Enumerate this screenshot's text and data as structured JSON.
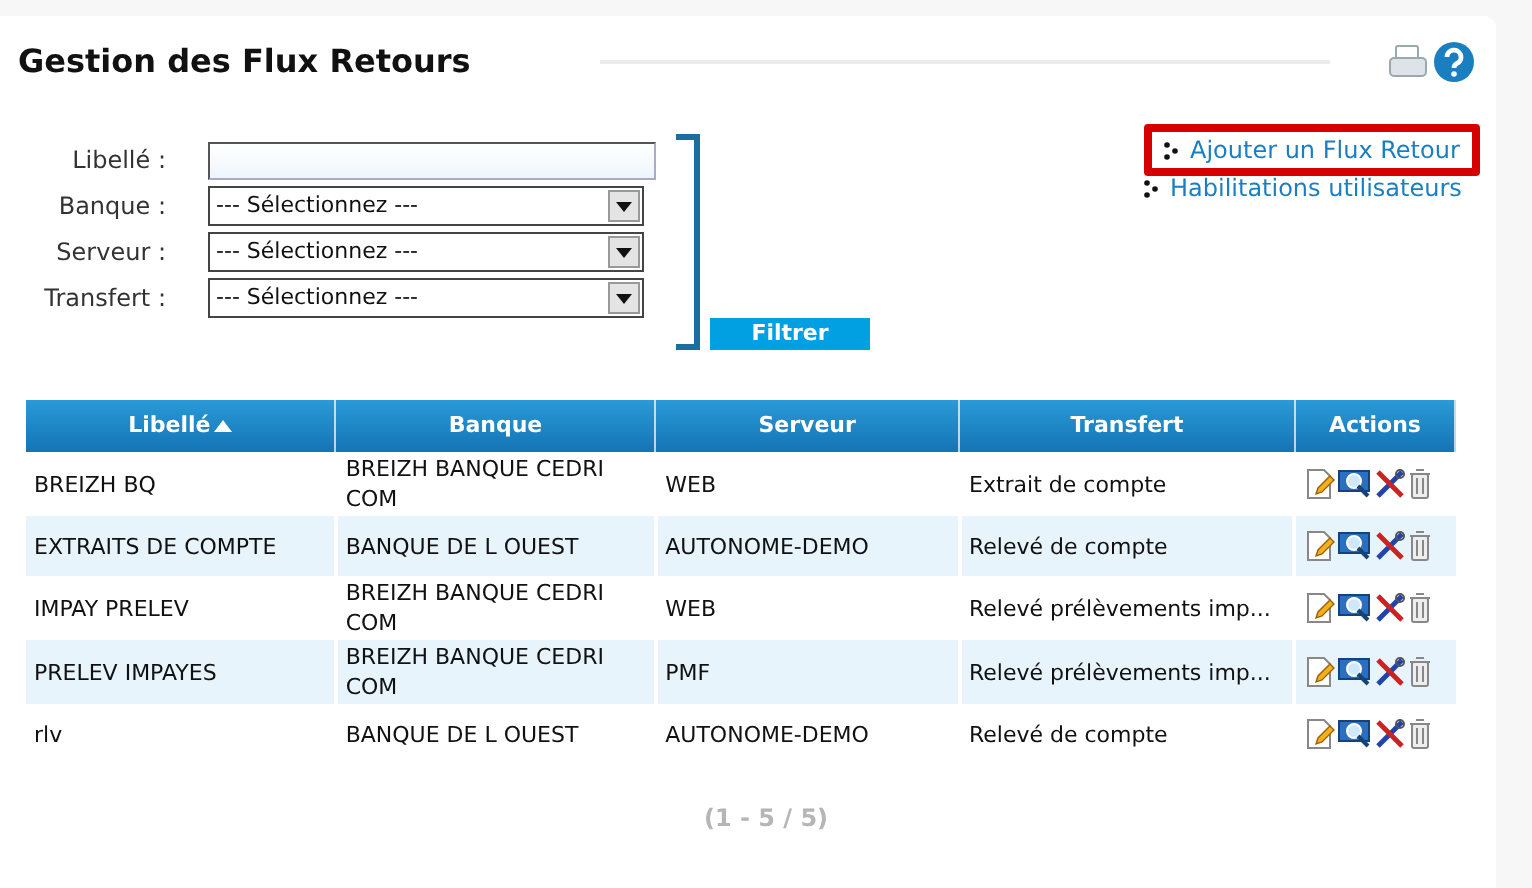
{
  "page": {
    "title": "Gestion des Flux Retours"
  },
  "filters": [
    {
      "kind": "text",
      "label": "Libellé :"
    },
    {
      "kind": "select",
      "label": "Banque :",
      "value": "--- Sélectionnez ---"
    },
    {
      "kind": "select",
      "label": "Serveur :",
      "value": "--- Sélectionnez ---"
    },
    {
      "kind": "select",
      "label": "Transfert :",
      "value": "--- Sélectionnez ---"
    }
  ],
  "filter_button": "Filtrer",
  "links": [
    {
      "label": "Ajouter un Flux Retour",
      "highlighted": true
    },
    {
      "label": "Habilitations utilisateurs",
      "highlighted": false
    }
  ],
  "table": {
    "columns": [
      {
        "label": "Libellé",
        "sorted": true
      },
      {
        "label": "Banque",
        "sorted": false
      },
      {
        "label": "Serveur",
        "sorted": false
      },
      {
        "label": "Transfert",
        "sorted": false
      },
      {
        "label": "Actions",
        "sorted": false
      }
    ],
    "rows": [
      {
        "cells": [
          "BREIZH BQ",
          "BREIZH BANQUE CEDRI COM",
          "WEB",
          "Extrait de compte"
        ]
      },
      {
        "cells": [
          "EXTRAITS DE COMPTE",
          "BANQUE DE L OUEST",
          "AUTONOME-DEMO",
          "Relevé de compte"
        ]
      },
      {
        "cells": [
          "IMPAY PRELEV",
          "BREIZH BANQUE CEDRI COM",
          "WEB",
          "Relevé prélèvements imp..."
        ]
      },
      {
        "cells": [
          "PRELEV IMPAYES",
          "BREIZH BANQUE CEDRI COM",
          "PMF",
          "Relevé prélèvements imp..."
        ]
      },
      {
        "cells": [
          "rlv",
          "BANQUE DE L OUEST",
          "AUTONOME-DEMO",
          "Relevé de compte"
        ]
      }
    ]
  },
  "pagination": "(1 - 5 / 5)"
}
